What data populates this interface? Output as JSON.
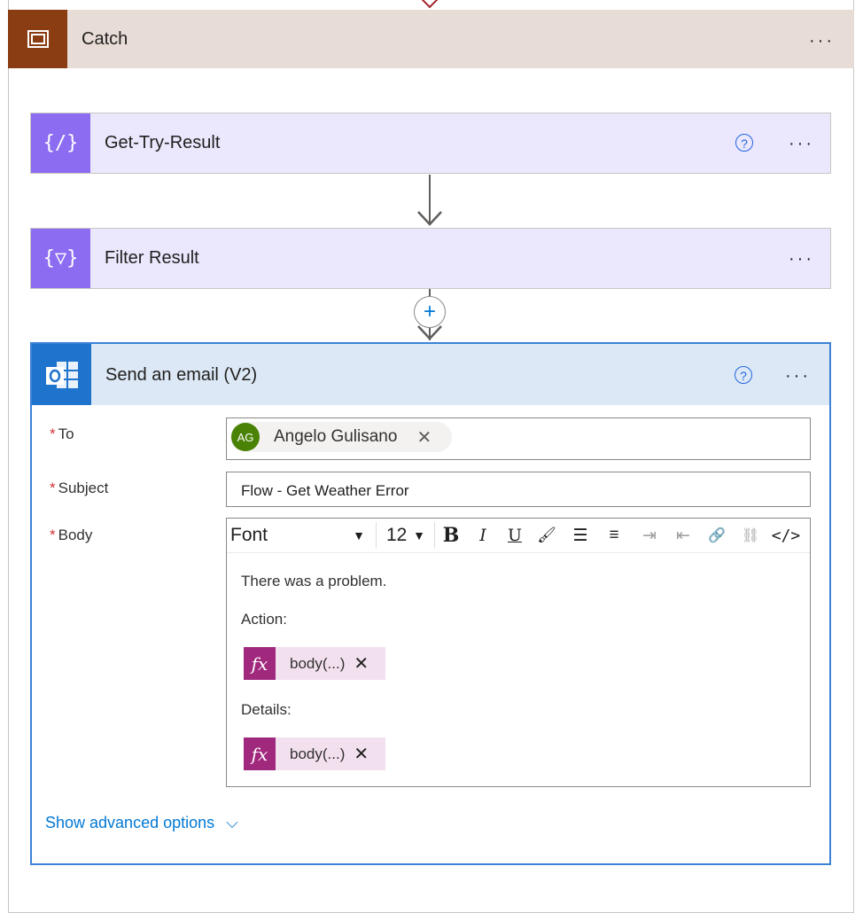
{
  "scope": {
    "title": "Catch",
    "more_label": "···"
  },
  "actions": [
    {
      "title": "Get-Try-Result",
      "icon": "{∕}",
      "help": "?",
      "more_label": "···"
    },
    {
      "title": "Filter Result",
      "icon": "{▽}",
      "more_label": "···"
    }
  ],
  "insert": {
    "label": "+"
  },
  "email": {
    "title": "Send an email (V2)",
    "help": "?",
    "more_label": "···",
    "required_mark": "*",
    "to": {
      "label": "To",
      "recipient_initials": "AG",
      "recipient_name": "Angelo Gulisano",
      "remove": "✕"
    },
    "subject": {
      "label": "Subject",
      "value": "Flow - Get Weather Error"
    },
    "body": {
      "label": "Body",
      "toolbar": {
        "font": "Font",
        "size": "12",
        "caret": "▼",
        "bold": "B",
        "italic": "I",
        "underline": "U",
        "color": "🖌",
        "bullets": "☰",
        "numbered": "≡",
        "indent": "⇥",
        "outdent": "⇤",
        "link": "🔗",
        "unlink": "⛓",
        "code": "</>"
      },
      "lines": [
        "There was a problem.",
        "Action:",
        "Details:"
      ],
      "expressions": [
        {
          "fx": "fx",
          "text": "body(...)",
          "remove": "✕"
        },
        {
          "fx": "fx",
          "text": "body(...)",
          "remove": "✕"
        }
      ]
    },
    "advanced": {
      "label": "Show advanced options",
      "chevron": "⌵"
    }
  },
  "colors": {
    "scope_header": "#e8ddd6",
    "scope_icon": "#8a3c13",
    "action_card": "#ebe7fd",
    "action_icon": "#8c6cf1",
    "email_header": "#dce8f5",
    "email_icon": "#1e73cc",
    "expression": "#a0297e",
    "link": "#0078d4",
    "required": "#d13438"
  }
}
